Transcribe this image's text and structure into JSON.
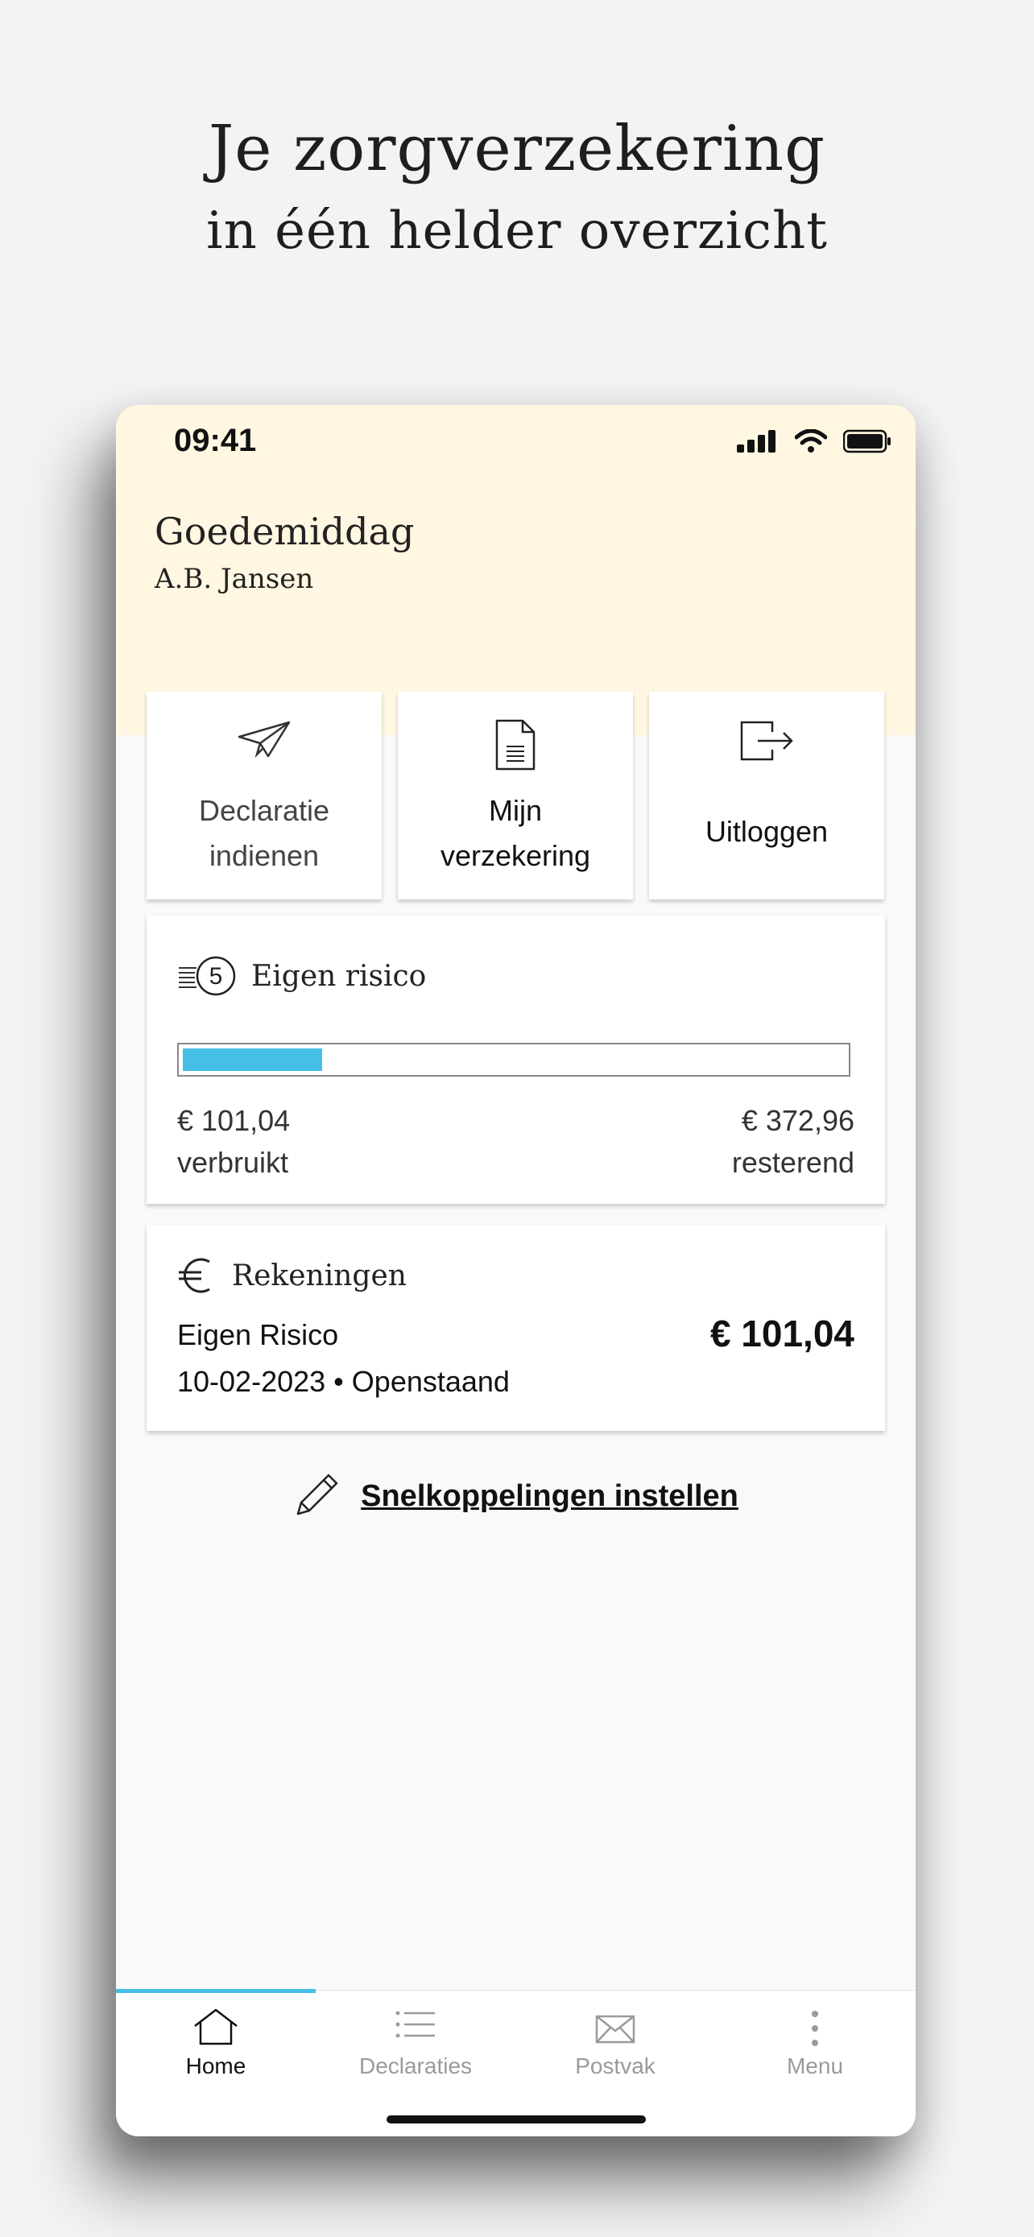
{
  "promo": {
    "title": "Je zorgverzekering",
    "subtitle": "in één helder overzicht"
  },
  "status_bar": {
    "time": "09:41",
    "icons": [
      "signal-icon",
      "wifi-icon",
      "battery-icon"
    ]
  },
  "header": {
    "greeting": "Goedemiddag",
    "user_name": "A.B. Jansen"
  },
  "quick_actions": [
    {
      "icon": "paper-plane-icon",
      "line1": "Declaratie",
      "line2": "indienen",
      "color": "#444444"
    },
    {
      "icon": "document-icon",
      "line1": "Mijn",
      "line2": "verzekering",
      "color": "#111111"
    },
    {
      "icon": "logout-icon",
      "line1": "Uitloggen",
      "color": "#111111"
    }
  ],
  "eigen_risico": {
    "title": "Eigen risico",
    "icon": "coins-five-icon",
    "coin_number": "5",
    "used_amount": "€ 101,04",
    "used_label": "verbruikt",
    "remaining_amount": "€ 372,96",
    "remaining_label": "resterend",
    "progress_fraction": 0.21,
    "bar_color": "#45bfe6"
  },
  "rekeningen": {
    "title": "Rekeningen",
    "icon": "euro-icon",
    "item": {
      "type": "Eigen Risico",
      "amount": "€ 101,04",
      "date": "10-02-2023",
      "separator": "•",
      "status": "Openstaand"
    }
  },
  "shortcuts": {
    "icon": "pencil-icon",
    "label": "Snelkoppelingen instellen"
  },
  "tabbar": {
    "active_color": "#111111",
    "inactive_color": "#9a9a9a",
    "accent": "#45bfe6",
    "tabs": [
      {
        "label": "Home",
        "icon": "home-icon",
        "active": true
      },
      {
        "label": "Declaraties",
        "icon": "list-icon",
        "active": false
      },
      {
        "label": "Postvak",
        "icon": "envelope-icon",
        "active": false
      },
      {
        "label": "Menu",
        "icon": "more-vertical-icon",
        "active": false
      }
    ]
  }
}
